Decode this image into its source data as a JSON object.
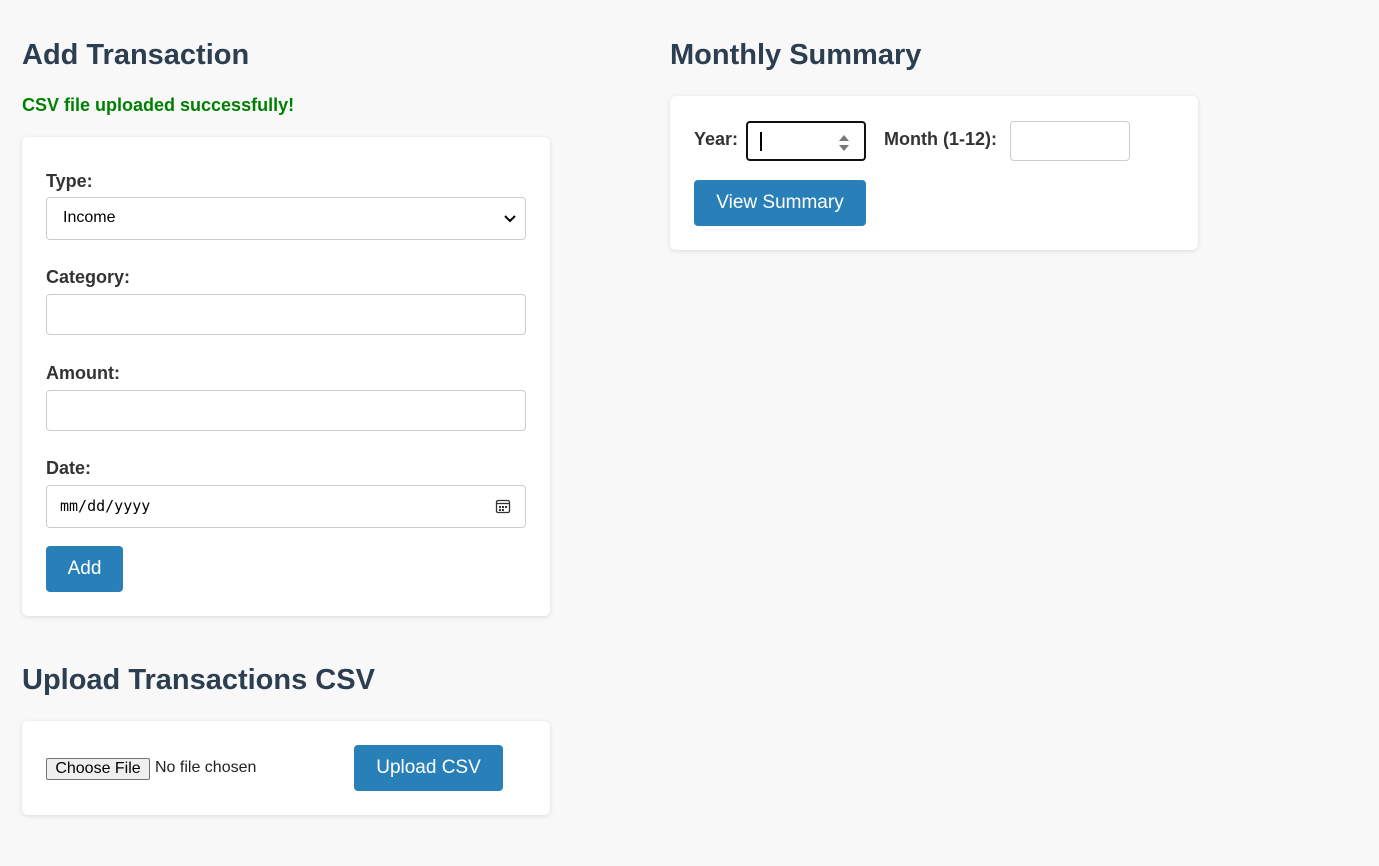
{
  "add_transaction": {
    "title": "Add Transaction",
    "success_message": "CSV file uploaded successfully!",
    "type_label": "Type:",
    "type_value": "Income",
    "category_label": "Category:",
    "category_value": "",
    "amount_label": "Amount:",
    "amount_value": "",
    "date_label": "Date:",
    "date_placeholder": "mm/dd/yyyy",
    "add_button": "Add"
  },
  "upload": {
    "title": "Upload Transactions CSV",
    "choose_file_label": "Choose File",
    "file_status": "No file chosen",
    "upload_button": "Upload CSV"
  },
  "summary": {
    "title": "Monthly Summary",
    "year_label": "Year:",
    "year_value": "",
    "month_label": "Month (1-12):",
    "month_value": "",
    "view_button": "View Summary"
  },
  "colors": {
    "accent": "#2980b9",
    "heading": "#2c3e50",
    "success": "#008000",
    "background": "#f8f8f8"
  }
}
